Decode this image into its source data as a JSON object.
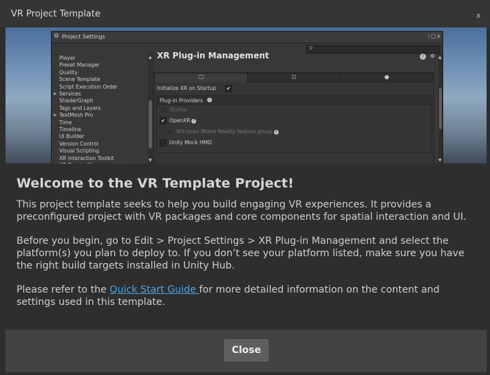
{
  "window": {
    "title": "VR Project Template",
    "close_label": "x"
  },
  "screenshot": {
    "panel_title": "Project Settings",
    "sidebar_items": [
      {
        "label": "Player",
        "arrow": false
      },
      {
        "label": "Preset Manager",
        "arrow": false
      },
      {
        "label": "Quality",
        "arrow": false
      },
      {
        "label": "Scene Template",
        "arrow": false
      },
      {
        "label": "Script Execution Order",
        "arrow": false
      },
      {
        "label": "Services",
        "arrow": true
      },
      {
        "label": "ShaderGraph",
        "arrow": false
      },
      {
        "label": "Tags and Layers",
        "arrow": false
      },
      {
        "label": "TextMesh Pro",
        "arrow": true
      },
      {
        "label": "Time",
        "arrow": false
      },
      {
        "label": "Timeline",
        "arrow": false
      },
      {
        "label": "UI Builder",
        "arrow": false
      },
      {
        "label": "Version Control",
        "arrow": false
      },
      {
        "label": "Visual Scripting",
        "arrow": false
      },
      {
        "label": "XR Interaction Toolkit",
        "arrow": false
      },
      {
        "label": "XR Plug-in Management",
        "arrow": true,
        "selected": true
      }
    ],
    "main_title": "XR Plug-in Management",
    "tabs": [
      {
        "name": "desktop-icon",
        "glyph": "🖵"
      },
      {
        "name": "standalone-icon",
        "glyph": "☷"
      },
      {
        "name": "android-icon",
        "glyph": "⬣"
      }
    ],
    "init_label": "Initialize XR on Startup",
    "providers_label": "Plug-in Providers",
    "providers": [
      {
        "label": "Oculus",
        "checked": false,
        "disabled": true
      },
      {
        "label": "OpenXR",
        "checked": true,
        "disabled": false
      },
      {
        "label": "Windows Mixed Reality feature group",
        "checked": false,
        "disabled": true
      },
      {
        "label": "Unity Mock HMD",
        "checked": false,
        "disabled": false
      }
    ],
    "check_glyph": "✔",
    "help_glyph": "?",
    "gear_glyph": "⚙",
    "search_glyph": "⚲",
    "menu_glyph": "⋮",
    "max_glyph": "▢",
    "close_glyph": "x",
    "up_glyph": "▲",
    "down_glyph": "▼",
    "arrow_glyph": "▶"
  },
  "content": {
    "heading": "Welcome to the VR Template Project!",
    "para1": "This project template seeks to help you build engaging VR experiences. It provides a preconfigured project with VR packages and core components for spatial interaction and UI.",
    "para2": "Before you begin, go to Edit > Project Settings > XR Plug-in Management and select the platform(s) you plan to deploy to. If you don’t see your platform listed, make sure you have the right build targets installed in Unity Hub.",
    "para3_before": "Please refer to the ",
    "para3_link": "Quick Start Guide ",
    "para3_after": "for more detailed information on the content and settings used in this template."
  },
  "footer": {
    "close_button": "Close"
  },
  "colors": {
    "link": "#4ca3e8",
    "selection": "#2c5d87",
    "background": "#2e2e2e",
    "footer": "#434343"
  }
}
